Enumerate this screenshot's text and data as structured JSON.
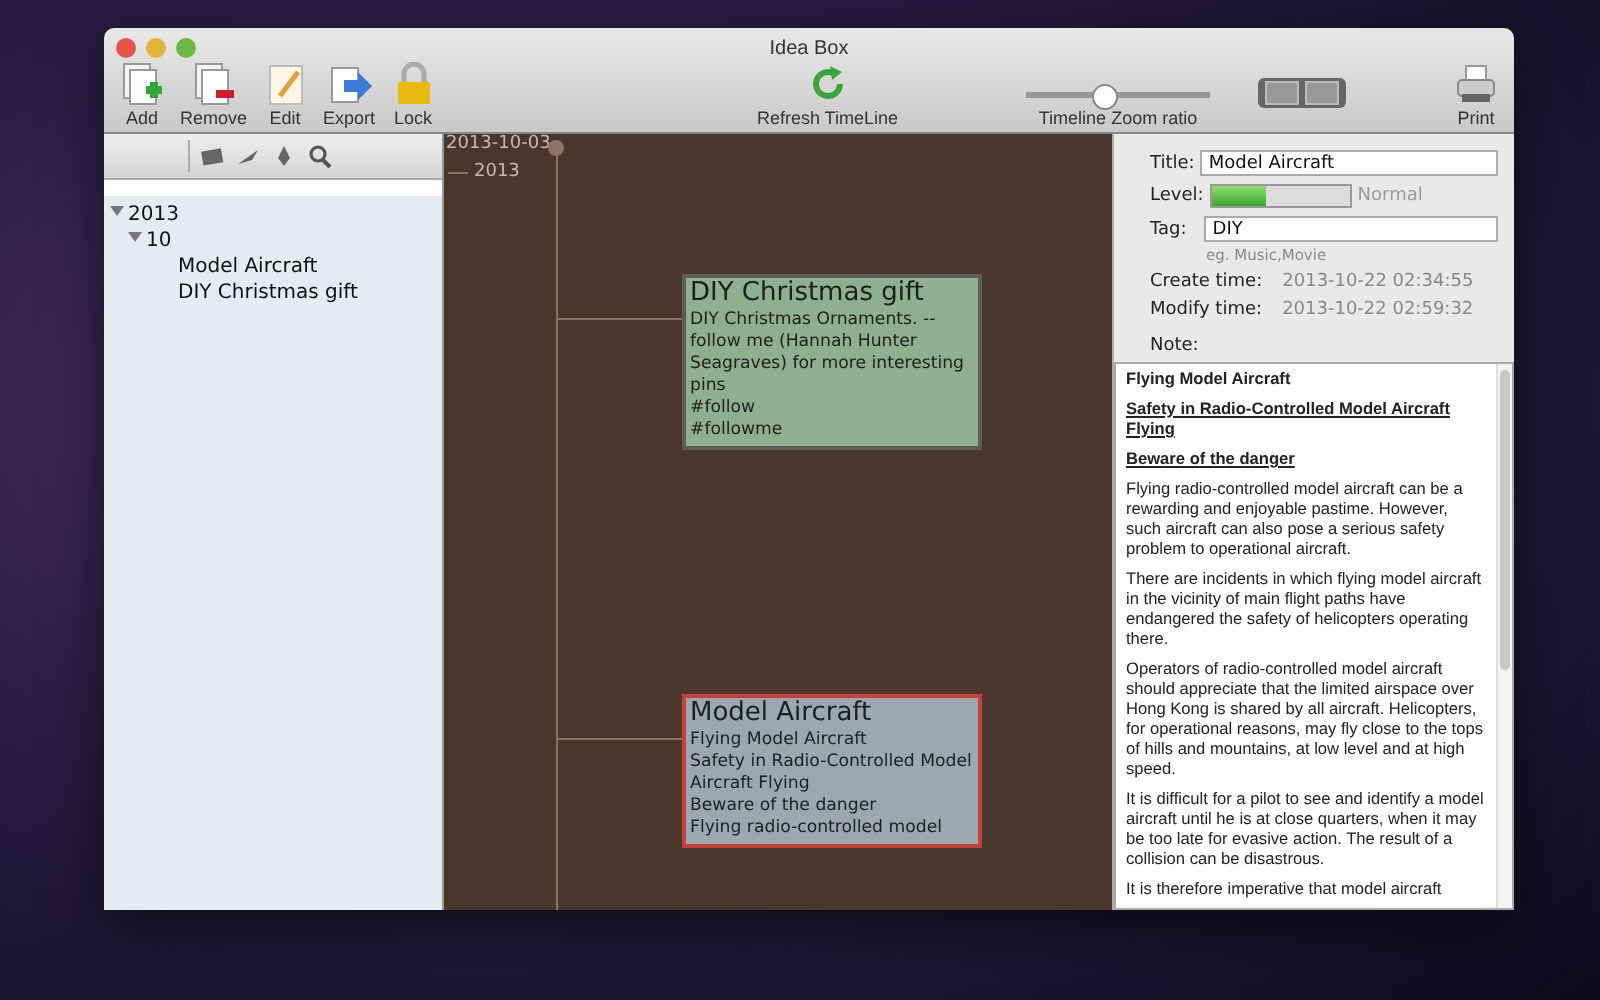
{
  "window": {
    "title": "Idea Box"
  },
  "toolbar": {
    "left": [
      {
        "kind": "add",
        "label": "Add"
      },
      {
        "kind": "remove",
        "label": "Remove"
      },
      {
        "kind": "edit",
        "label": "Edit"
      },
      {
        "kind": "export",
        "label": "Export"
      },
      {
        "kind": "lock",
        "label": "Lock"
      }
    ],
    "refresh": {
      "label": "Refresh TimeLine"
    },
    "zoom": {
      "label": "Timeline Zoom ratio",
      "level": 0.42
    },
    "print": {
      "label": "Print"
    }
  },
  "sidebar": {
    "tree": [
      {
        "label": "2013",
        "expanded": true,
        "children": [
          {
            "label": "10",
            "expanded": true,
            "children": [
              {
                "label": "Model Aircraft"
              },
              {
                "label": "DIY Christmas gift"
              }
            ]
          }
        ]
      }
    ]
  },
  "timeline": {
    "date": "2013-10-03",
    "year": "2013",
    "cards": [
      {
        "title": "DIY Christmas gift",
        "lines": [
          "DIY Christmas Ornaments. --follow me (Hannah Hunter Seagraves) for more interesting pins",
          "#follow",
          "#followme"
        ],
        "selected": false,
        "color": "#8fb08f"
      },
      {
        "title": "Model Aircraft",
        "lines": [
          "Flying Model Aircraft",
          "Safety in Radio-Controlled Model Aircraft Flying",
          "Beware of the danger",
          "Flying radio-controlled model"
        ],
        "selected": true,
        "color": "#9ca8ae"
      }
    ]
  },
  "inspector": {
    "title": {
      "label": "Title:",
      "value": "Model Aircraft"
    },
    "level": {
      "label": "Level:",
      "level": 0.4,
      "reading": "Normal"
    },
    "tag": {
      "label": "Tag:",
      "value": "DIY",
      "hint": "eg. Music,Movie"
    },
    "create": {
      "label": "Create time:",
      "value": "2013-10-22 02:34:55"
    },
    "modify": {
      "label": "Modify time:",
      "value": "2013-10-22 02:59:32"
    },
    "note": {
      "label": "Note:",
      "paragraphs": [
        {
          "kind": "heading",
          "text": "Flying Model Aircraft"
        },
        {
          "kind": "subheading",
          "text": "Safety in Radio-Controlled Model Aircraft Flying"
        },
        {
          "kind": "subheading",
          "text": "Beware of the danger"
        },
        {
          "kind": "body",
          "text": "Flying radio-controlled model aircraft can be a rewarding and enjoyable pastime. However, such aircraft can also pose a serious safety problem to operational aircraft."
        },
        {
          "kind": "body",
          "text": "There are incidents in which flying model aircraft in the vicinity of main flight paths have endangered the safety of helicopters operating there."
        },
        {
          "kind": "body",
          "text": "Operators of radio-controlled model aircraft should appreciate that the limited airspace over Hong Kong is shared by all aircraft. Helicopters, for operational reasons, may fly close to the tops of hills and mountains, at low level and at high speed."
        },
        {
          "kind": "body",
          "text": "It is difficult for a pilot to see and identify a model aircraft until he is at close quarters, when it may be too late for evasive action. The result of a collision can be disastrous."
        },
        {
          "kind": "body",
          "text": "It is therefore imperative that model aircraft"
        }
      ]
    }
  }
}
